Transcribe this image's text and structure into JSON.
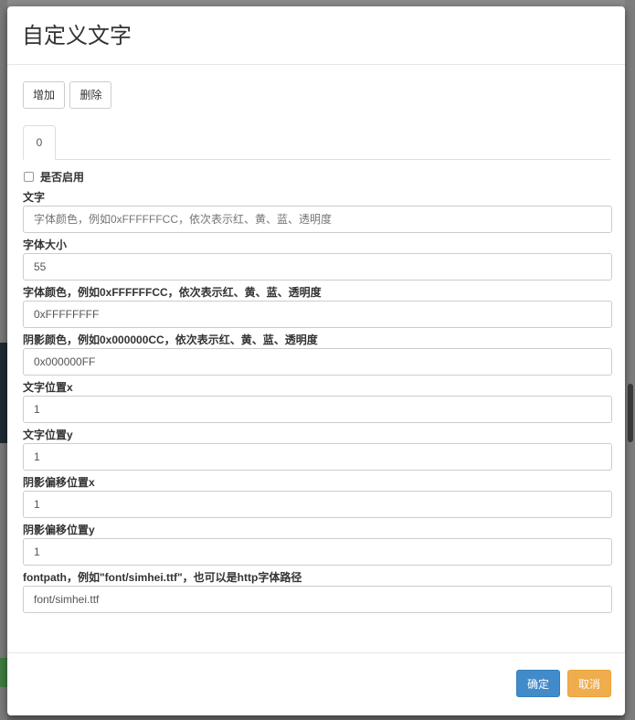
{
  "modal": {
    "title": "自定义文字"
  },
  "toolbar": {
    "add_label": "增加",
    "delete_label": "删除"
  },
  "tabs": [
    {
      "label": "0"
    }
  ],
  "enable": {
    "label": "是否启用",
    "checked": false
  },
  "fields": [
    {
      "label": "文字",
      "value": "",
      "placeholder": "字体颜色，例如0xFFFFFFCC，依次表示红、黄、蓝、透明度"
    },
    {
      "label": "字体大小",
      "value": "55",
      "placeholder": ""
    },
    {
      "label": "字体颜色，例如0xFFFFFFCC，依次表示红、黄、蓝、透明度",
      "value": "0xFFFFFFFF",
      "placeholder": ""
    },
    {
      "label": "阴影颜色，例如0x000000CC，依次表示红、黄、蓝、透明度",
      "value": "0x000000FF",
      "placeholder": ""
    },
    {
      "label": "文字位置x",
      "value": "1",
      "placeholder": ""
    },
    {
      "label": "文字位置y",
      "value": "1",
      "placeholder": ""
    },
    {
      "label": "阴影偏移位置x",
      "value": "1",
      "placeholder": ""
    },
    {
      "label": "阴影偏移位置y",
      "value": "1",
      "placeholder": ""
    },
    {
      "label": "fontpath，例如\"font/simhei.ttf\"，也可以是http字体路径",
      "value": "font/simhei.ttf",
      "placeholder": ""
    }
  ],
  "footer": {
    "confirm_label": "确定",
    "cancel_label": "取消"
  },
  "colors": {
    "primary": "#428bca",
    "warning": "#f0ad4e",
    "border": "#cccccc",
    "text": "#333333"
  }
}
